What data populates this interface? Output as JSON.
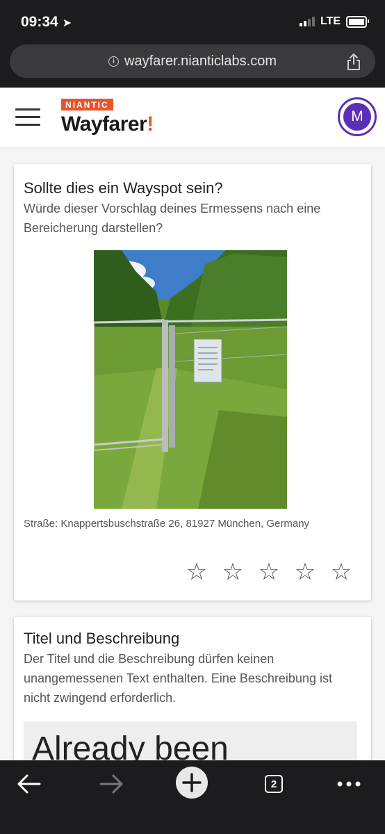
{
  "status_bar": {
    "time": "09:34",
    "network": "LTE"
  },
  "browser": {
    "url": "wayfarer.nianticlabs.com",
    "tab_count": "2"
  },
  "app": {
    "brand_top": "NIANTIC",
    "brand_name": "Wayfarer",
    "brand_mark": "!",
    "avatar_initial": "M"
  },
  "card_wayspot": {
    "title": "Sollte dies ein Wayspot sein?",
    "subtitle": "Würde dieser Vorschlag deines Ermessens nach eine Bereicherung darstellen?",
    "address": "Straße: Knappertsbuschstraße 26, 81927 München, Germany",
    "rating": 0,
    "stars": [
      "☆",
      "☆",
      "☆",
      "☆",
      "☆"
    ]
  },
  "card_title_desc": {
    "title": "Titel und Beschreibung",
    "subtitle": "Der Titel und die Beschreibung dürfen keinen unangemessenen Text enthalten. Eine Beschreibung ist nicht zwingend erforderlich.",
    "submission_title": "Already been"
  },
  "colors": {
    "brand_orange": "#e8542b",
    "avatar_purple": "#5d2fb6",
    "chrome_dark": "#1c1c1e"
  }
}
